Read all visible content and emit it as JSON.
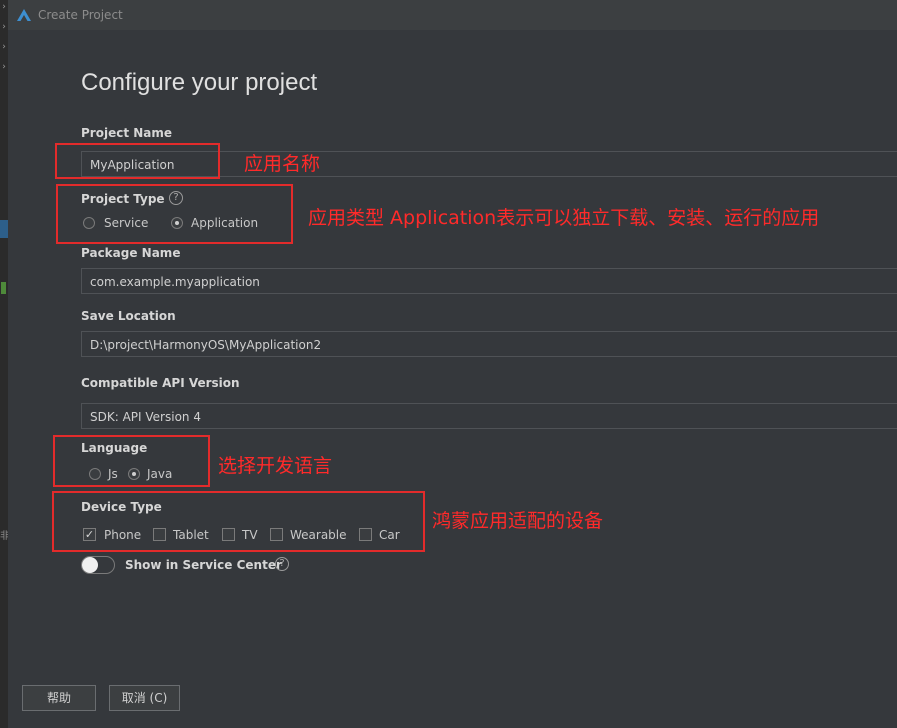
{
  "window": {
    "title": "Create Project"
  },
  "page": {
    "heading": "Configure your project"
  },
  "project_name": {
    "label": "Project Name",
    "value": "MyApplication"
  },
  "project_type": {
    "label": "Project Type",
    "help": "?",
    "options": [
      {
        "label": "Service",
        "selected": false
      },
      {
        "label": "Application",
        "selected": true
      }
    ]
  },
  "package_name": {
    "label": "Package Name",
    "value": "com.example.myapplication"
  },
  "save_location": {
    "label": "Save Location",
    "value": "D:\\project\\HarmonyOS\\MyApplication2"
  },
  "api_version": {
    "label": "Compatible API Version",
    "value": "SDK: API Version 4"
  },
  "language": {
    "label": "Language",
    "options": [
      {
        "label": "Js",
        "selected": false
      },
      {
        "label": "Java",
        "selected": true
      }
    ]
  },
  "device_type": {
    "label": "Device Type",
    "options": [
      {
        "label": "Phone",
        "checked": true
      },
      {
        "label": "Tablet",
        "checked": false
      },
      {
        "label": "TV",
        "checked": false
      },
      {
        "label": "Wearable",
        "checked": false
      },
      {
        "label": "Car",
        "checked": false
      }
    ]
  },
  "service_center": {
    "label": "Show in Service Center",
    "enabled": false,
    "help": "?"
  },
  "annotations": {
    "name": "应用名称",
    "type": "应用类型 Application表示可以独立下载、安装、运行的应用",
    "language": "选择开发语言",
    "device": "鸿蒙应用适配的设备"
  },
  "buttons": {
    "help": "帮助",
    "cancel": "取消 (C)"
  },
  "side": {
    "fragment": "非"
  },
  "colors": {
    "annotation": "#ff2a2a",
    "annotation_box": "#e32b2b",
    "background": "#35383c"
  }
}
